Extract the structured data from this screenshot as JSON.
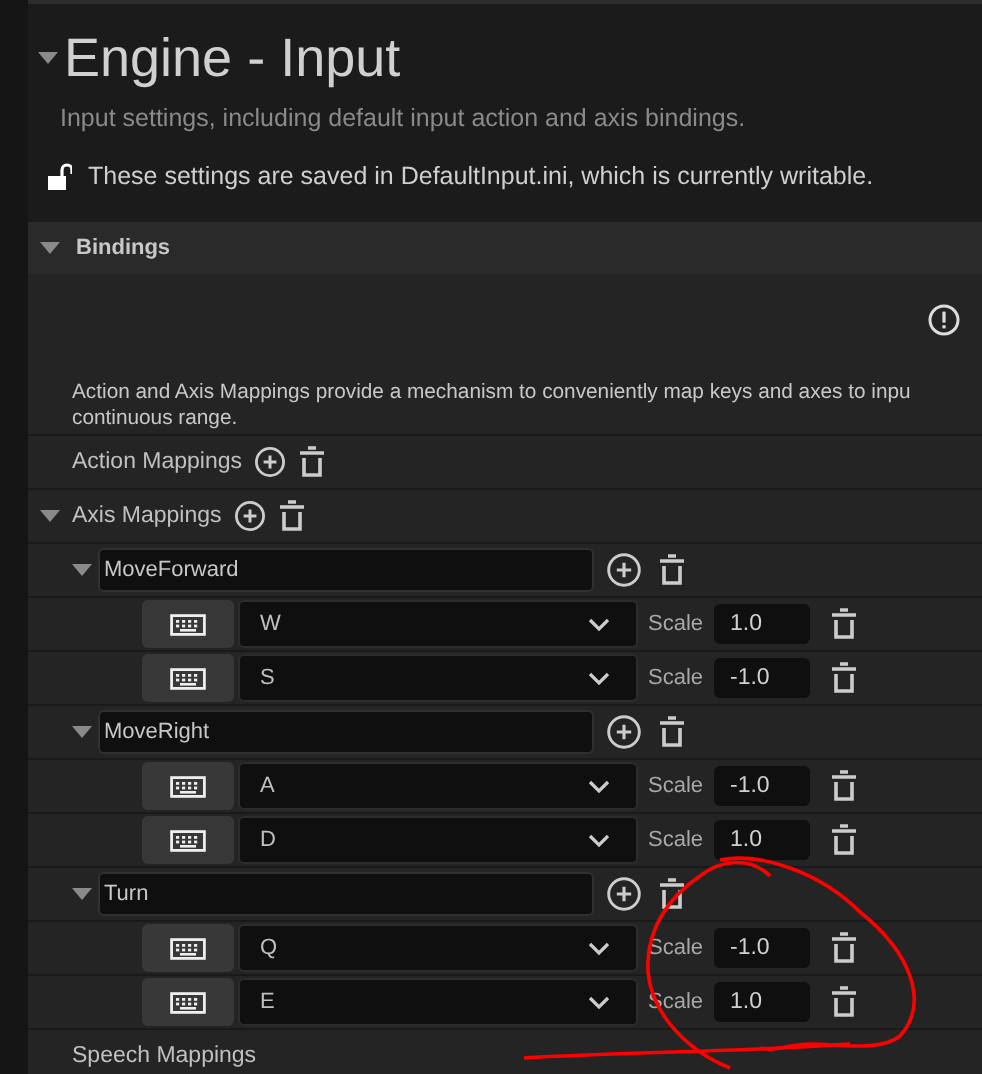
{
  "title": "Engine - Input",
  "expanded": true,
  "subtitle": "Input settings, including default input action and axis bindings.",
  "notice": {
    "text": "These settings are saved in DefaultInput.ini, which is currently writable.",
    "locked": false
  },
  "section": {
    "title": "Bindings",
    "expanded": true
  },
  "description": [
    "Action and Axis Mappings provide a mechanism to conveniently map keys and axes to inpu",
    "continuous range."
  ],
  "action_mappings": {
    "label": "Action Mappings"
  },
  "axis_mappings": {
    "label": "Axis Mappings",
    "expanded": true,
    "groups": [
      {
        "name": "MoveForward",
        "expanded": true,
        "keys": [
          {
            "key": "W",
            "scale_label": "Scale",
            "scale": "1.0"
          },
          {
            "key": "S",
            "scale_label": "Scale",
            "scale": "-1.0"
          }
        ]
      },
      {
        "name": "MoveRight",
        "expanded": true,
        "keys": [
          {
            "key": "A",
            "scale_label": "Scale",
            "scale": "-1.0"
          },
          {
            "key": "D",
            "scale_label": "Scale",
            "scale": "1.0"
          }
        ]
      },
      {
        "name": "Turn",
        "expanded": true,
        "keys": [
          {
            "key": "Q",
            "scale_label": "Scale",
            "scale": "-1.0"
          },
          {
            "key": "E",
            "scale_label": "Scale",
            "scale": "1.0"
          }
        ]
      }
    ]
  },
  "speech_mappings": {
    "label": "Speech Mappings"
  }
}
